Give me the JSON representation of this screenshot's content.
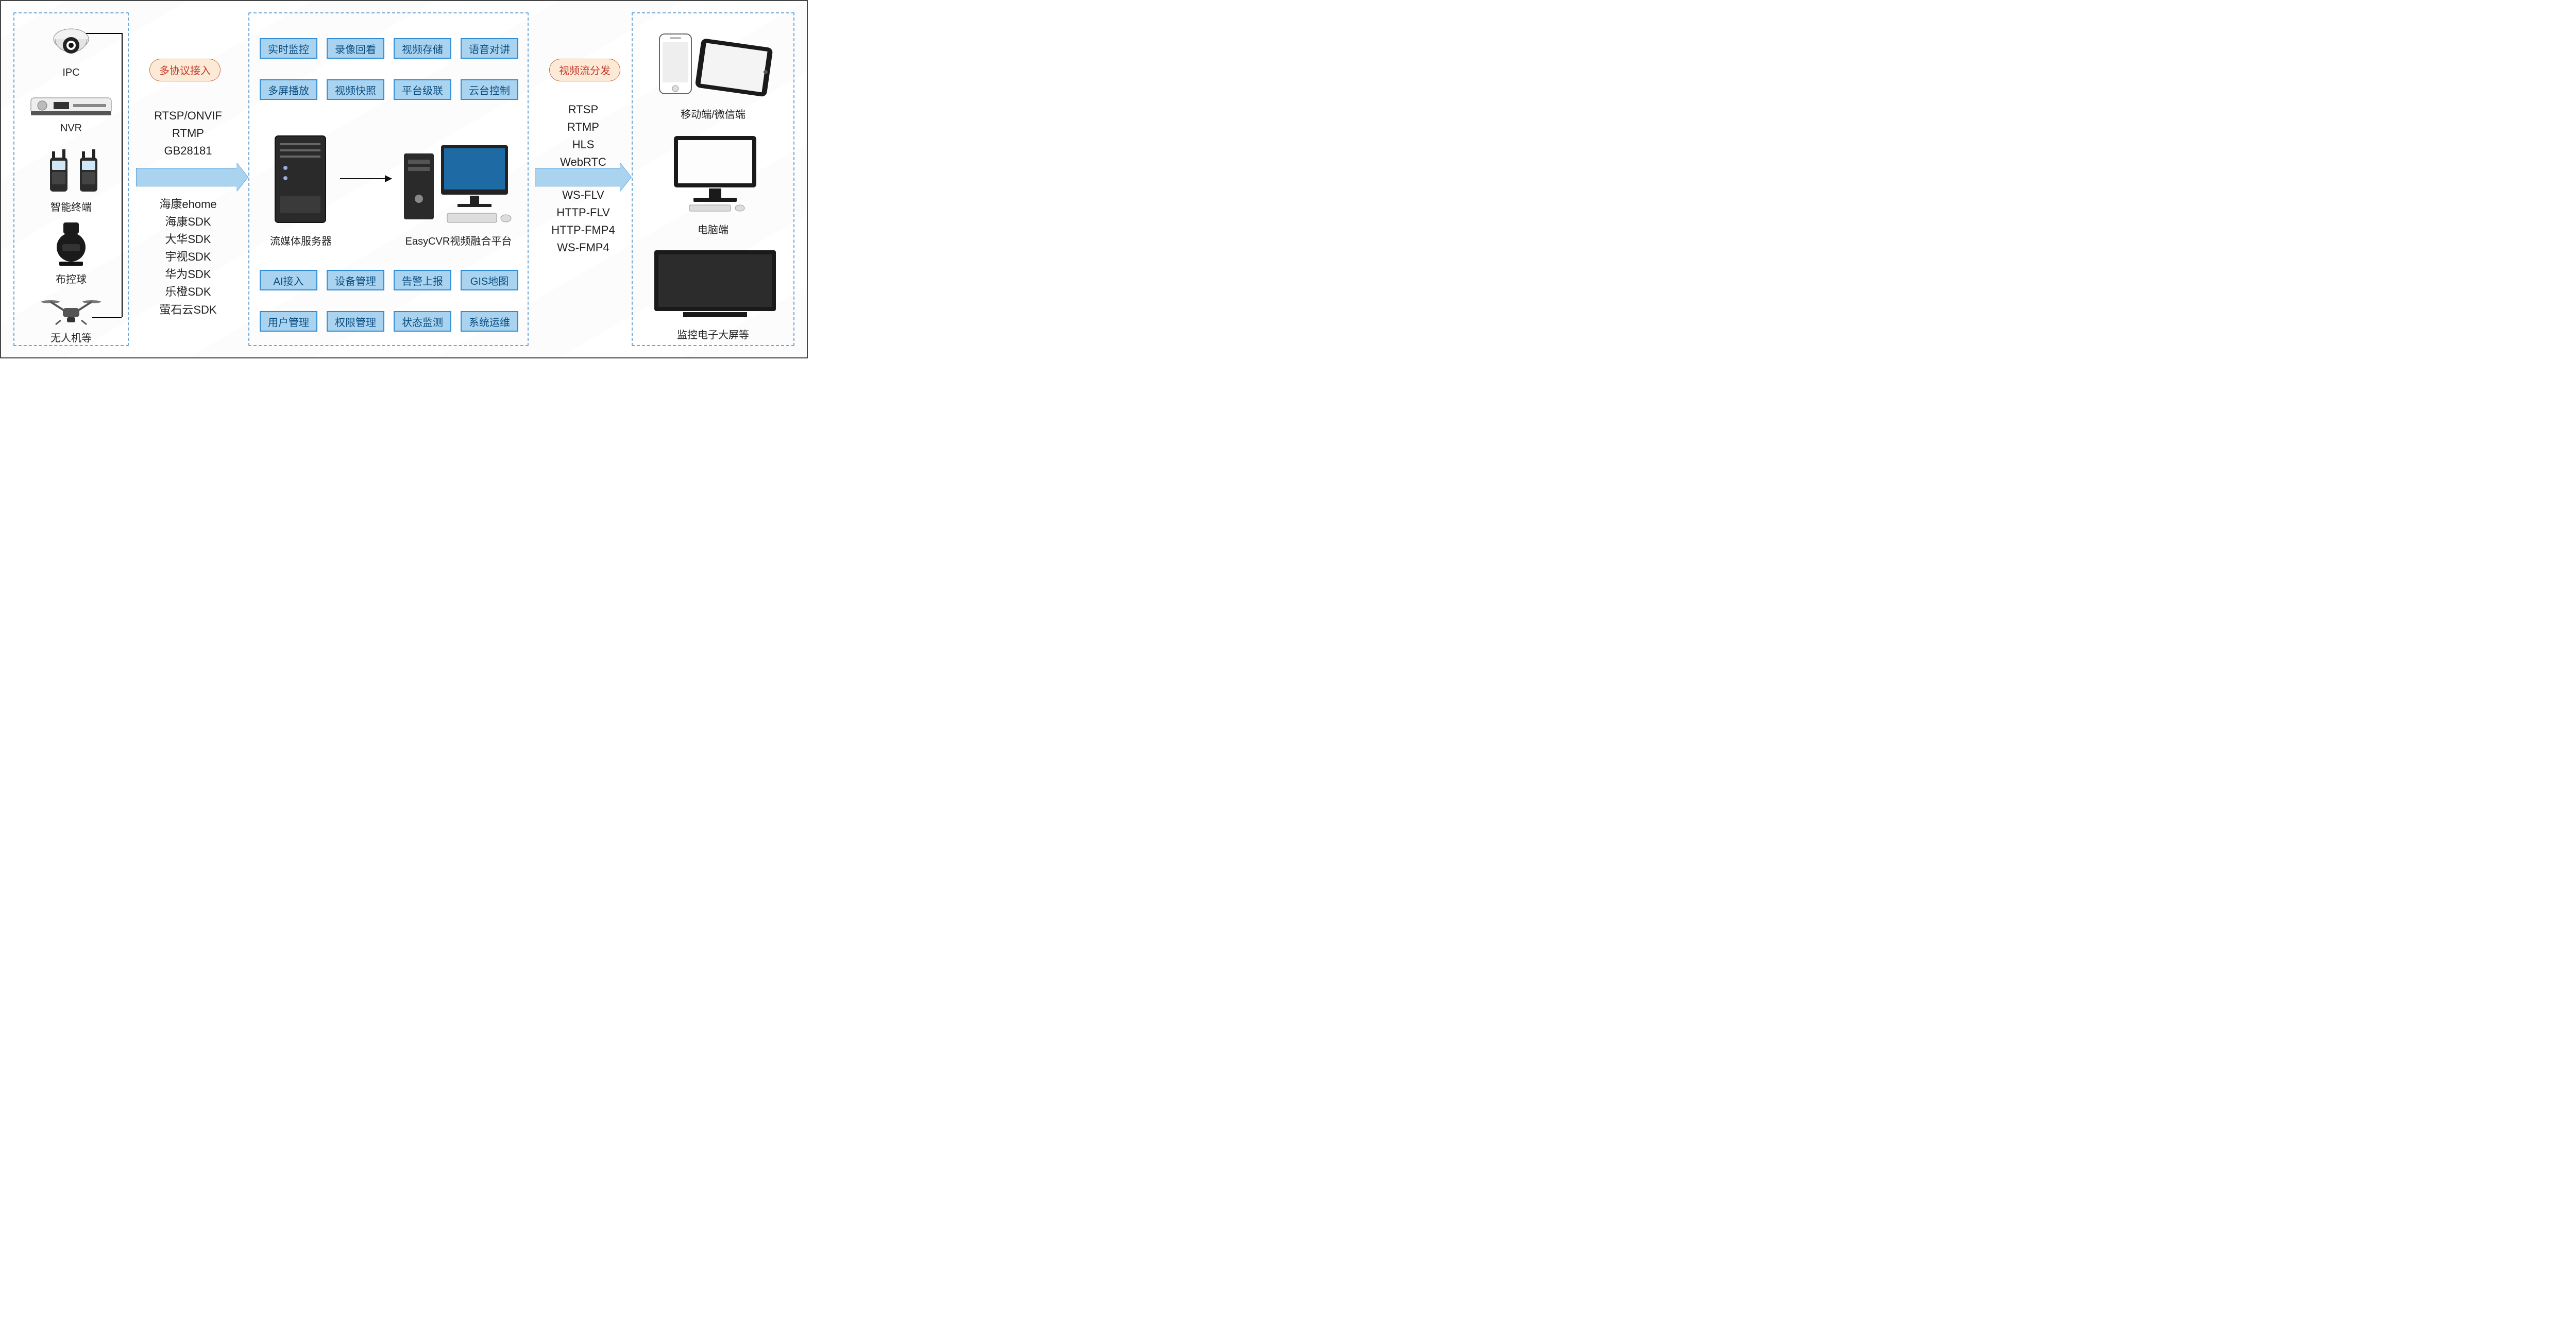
{
  "inputs": {
    "devices": [
      {
        "id": "ipc",
        "label": "IPC"
      },
      {
        "id": "nvr",
        "label": "NVR"
      },
      {
        "id": "term",
        "label": "智能终端"
      },
      {
        "id": "ball",
        "label": "布控球"
      },
      {
        "id": "uav",
        "label": "无人机等"
      }
    ]
  },
  "ingest": {
    "title": "多协议接入",
    "protocols_std": [
      "RTSP/ONVIF",
      "RTMP",
      "GB28181"
    ],
    "protocols_sdk": [
      "海康ehome",
      "海康SDK",
      "大华SDK",
      "宇视SDK",
      "华为SDK",
      "乐橙SDK",
      "萤石云SDK"
    ]
  },
  "platform": {
    "caps_top": [
      [
        "实时监控",
        "录像回看",
        "视频存储",
        "语音对讲"
      ],
      [
        "多屏播放",
        "视频快照",
        "平台级联",
        "云台控制"
      ]
    ],
    "server_label": "流媒体服务器",
    "product_label": "EasyCVR视频融合平台",
    "caps_bottom": [
      [
        "AI接入",
        "设备管理",
        "告警上报",
        "GIS地图"
      ],
      [
        "用户管理",
        "权限管理",
        "状态监测",
        "系统运维"
      ]
    ]
  },
  "distribute": {
    "title": "视频流分发",
    "formats_a": [
      "RTSP",
      "RTMP",
      "HLS",
      "WebRTC"
    ],
    "formats_b": [
      "WS-FLV",
      "HTTP-FLV",
      "HTTP-FMP4",
      "WS-FMP4"
    ]
  },
  "clients": {
    "mobile_label": "移动端/微信端",
    "pc_label": "电脑端",
    "wall_label": "监控电子大屏等"
  }
}
